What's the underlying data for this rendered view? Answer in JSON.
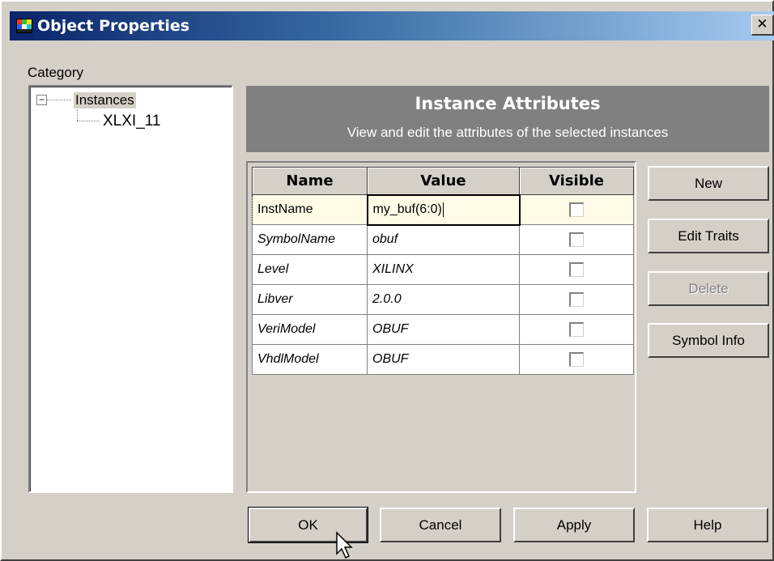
{
  "window": {
    "title": "Object Properties",
    "close_glyph": "✕"
  },
  "category": {
    "label": "Category",
    "tree": {
      "root": "Instances",
      "toggle": "−",
      "child": "XLXI_11"
    }
  },
  "header": {
    "title": "Instance Attributes",
    "subtitle": "View and edit the attributes of the selected instances"
  },
  "attributes": {
    "columns": [
      "Name",
      "Value",
      "Visible"
    ],
    "rows": [
      {
        "name": "InstName",
        "value": "my_buf(6:0)",
        "visible": false
      },
      {
        "name": "SymbolName",
        "value": "obuf",
        "visible": false
      },
      {
        "name": "Level",
        "value": "XILINX",
        "visible": false
      },
      {
        "name": "Libver",
        "value": "2.0.0",
        "visible": false
      },
      {
        "name": "VeriModel",
        "value": "OBUF",
        "visible": false
      },
      {
        "name": "VhdlModel",
        "value": "OBUF",
        "visible": false
      }
    ]
  },
  "side_buttons": {
    "new": "New",
    "edit_traits": "Edit Traits",
    "delete": "Delete",
    "symbol_info": "Symbol Info"
  },
  "footer_buttons": {
    "ok": "OK",
    "cancel": "Cancel",
    "apply": "Apply",
    "help": "Help"
  },
  "colors": {
    "title_gradient_start": "#0a246a",
    "header_bg": "#808080",
    "selected_row_bg": "#fffbe6"
  }
}
